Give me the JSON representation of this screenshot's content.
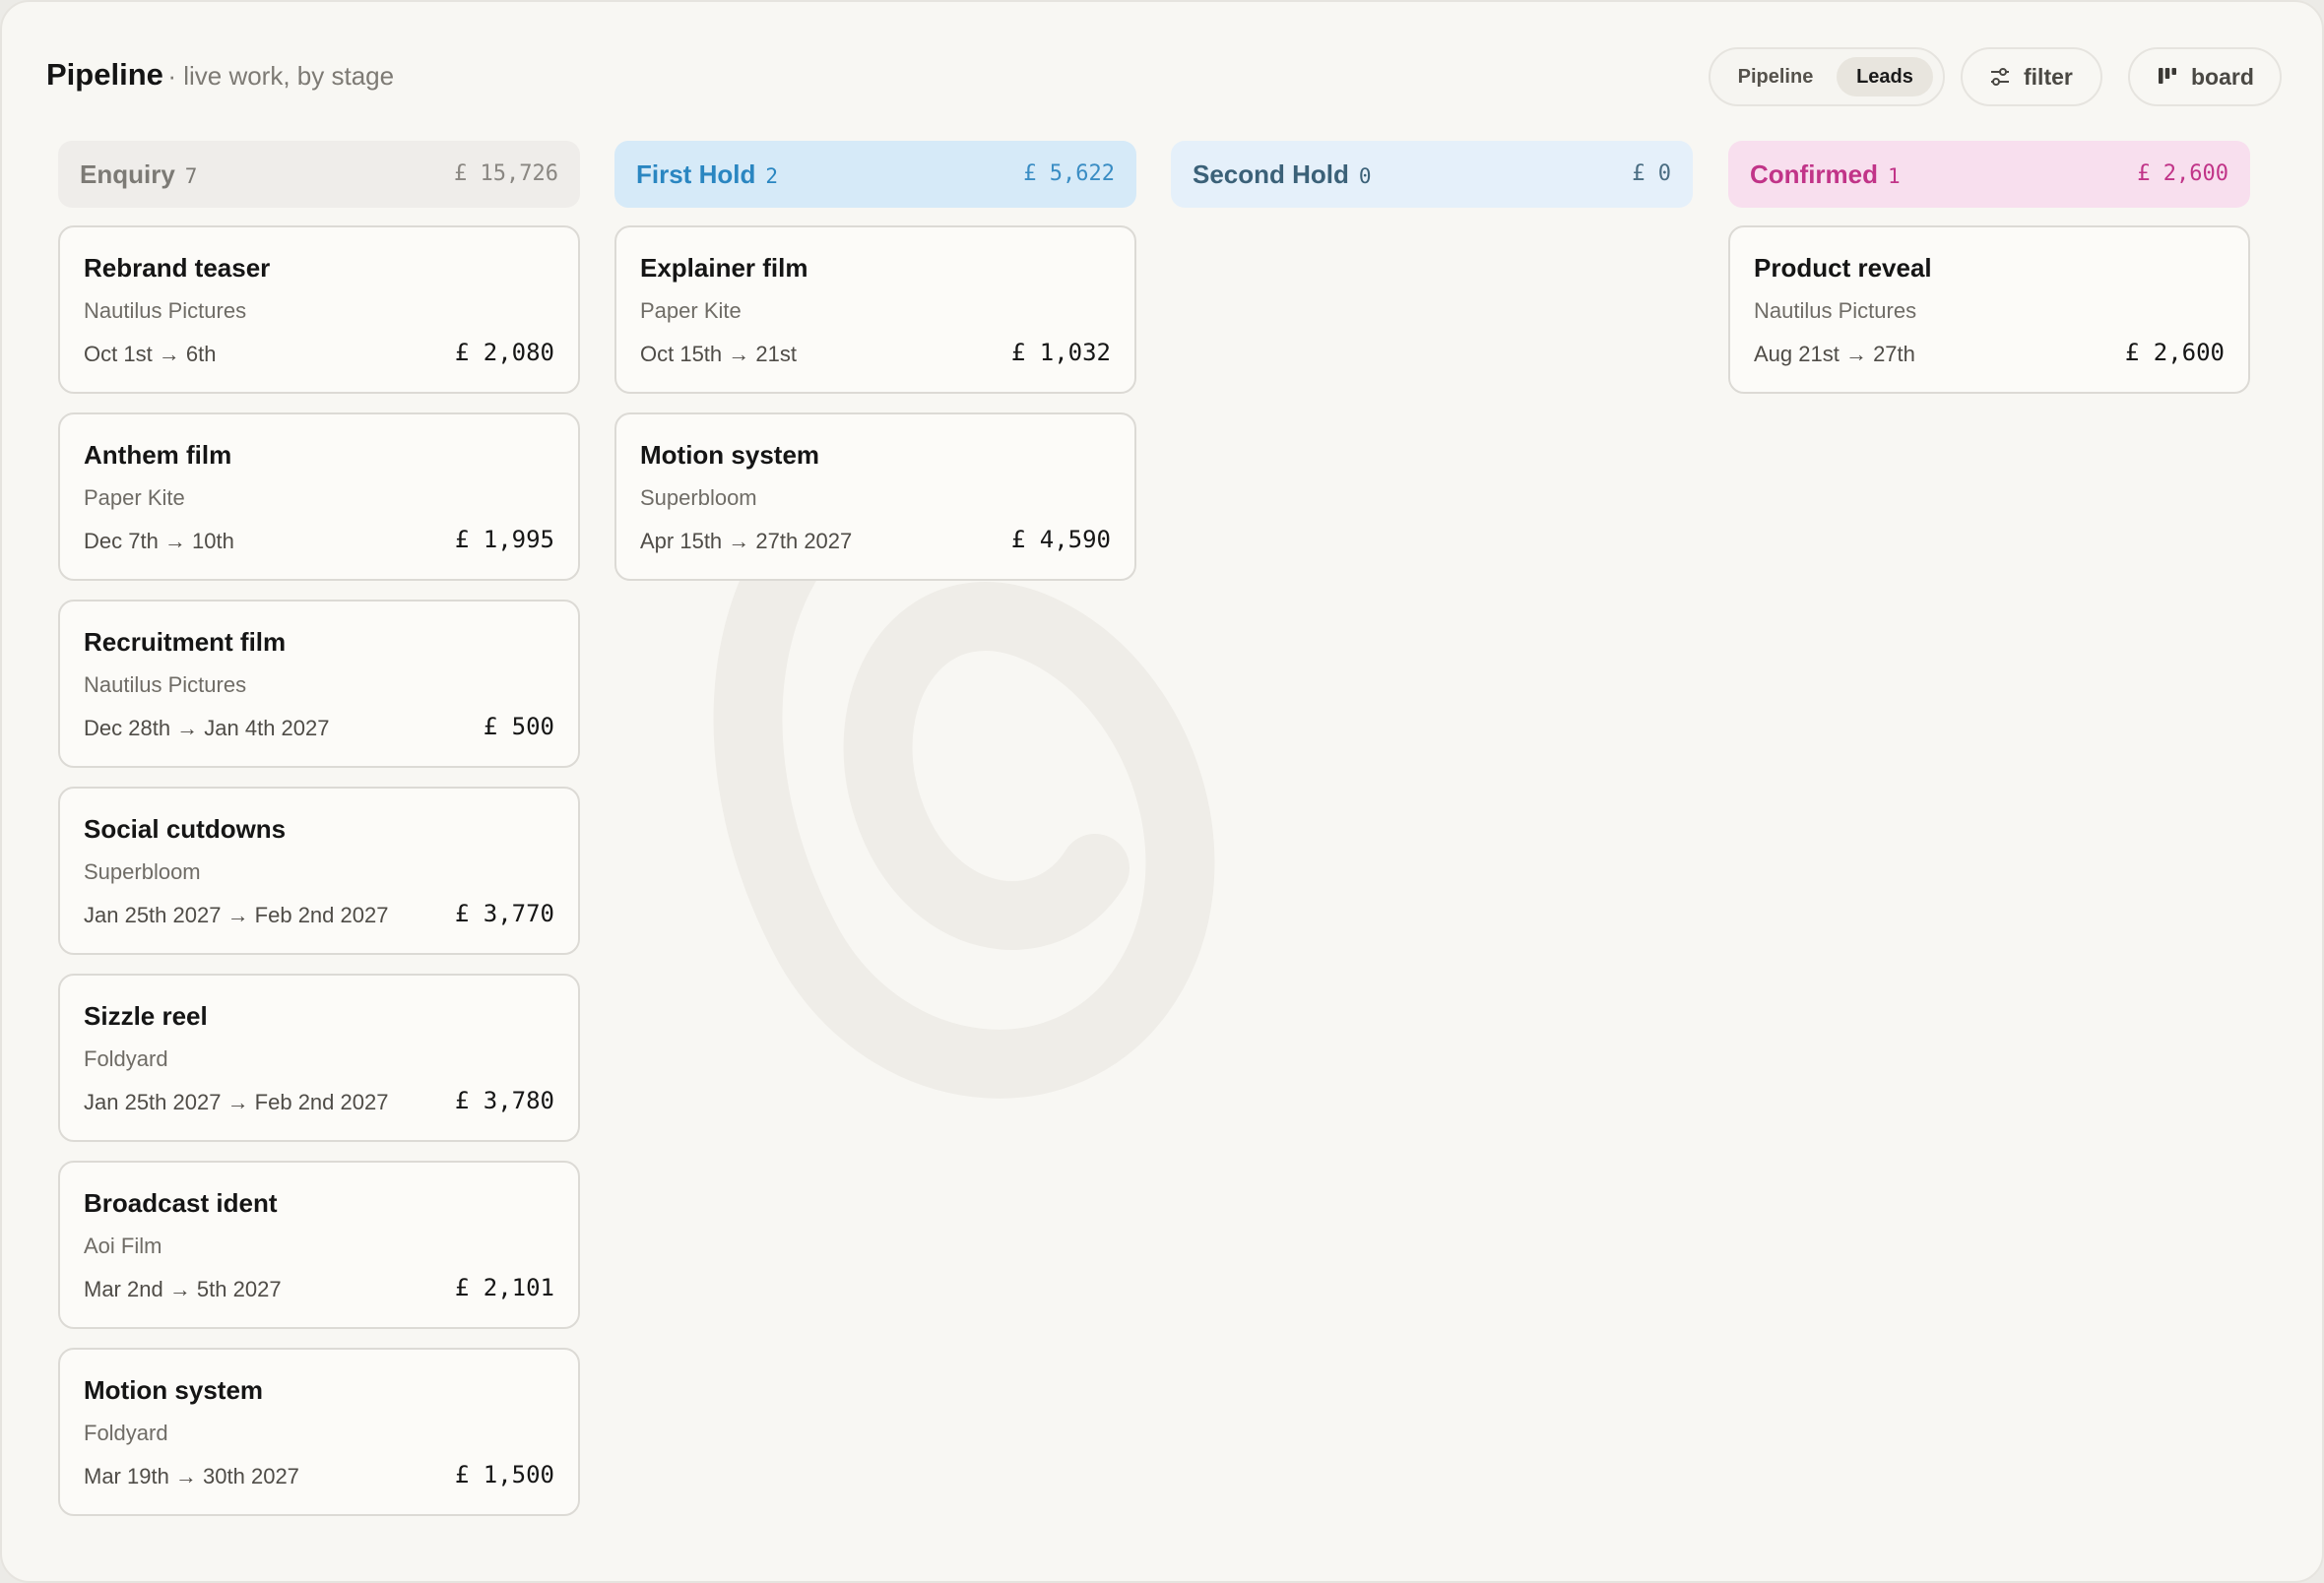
{
  "header": {
    "title": "Pipeline",
    "subtitle": "· live work, by stage",
    "view_toggle": {
      "pipeline_label": "Pipeline",
      "leads_label": "Leads",
      "active": "Leads"
    },
    "filter_label": "filter",
    "board_label": "board"
  },
  "colors": {
    "enquiry": {
      "bg": "#efedea",
      "text": "#7c7a75"
    },
    "first_hold": {
      "bg": "#d6eaf8",
      "text": "#2a86c1"
    },
    "second_hold": {
      "bg": "#e5f0fa",
      "text": "#3b6178"
    },
    "confirmed": {
      "bg": "#f8dfee",
      "text": "#c13488"
    }
  },
  "columns": [
    {
      "name": "Enquiry",
      "count": "7",
      "total": "£ 15,726",
      "cards": [
        {
          "title": "Rebrand teaser",
          "client": "Nautilus Pictures",
          "dates": "Oct 1st → 6th",
          "price": "£ 2,080"
        },
        {
          "title": "Anthem film",
          "client": "Paper Kite",
          "dates": "Dec 7th → 10th",
          "price": "£ 1,995"
        },
        {
          "title": "Recruitment film",
          "client": "Nautilus Pictures",
          "dates": "Dec 28th → Jan 4th 2027",
          "price": "£ 500"
        },
        {
          "title": "Social cutdowns",
          "client": "Superbloom",
          "dates": "Jan 25th 2027 → Feb 2nd 2027",
          "price": "£ 3,770"
        },
        {
          "title": "Sizzle reel",
          "client": "Foldyard",
          "dates": "Jan 25th 2027 → Feb 2nd 2027",
          "price": "£ 3,780"
        },
        {
          "title": "Broadcast ident",
          "client": "Aoi Film",
          "dates": "Mar 2nd → 5th 2027",
          "price": "£ 2,101"
        },
        {
          "title": "Motion system",
          "client": "Foldyard",
          "dates": "Mar 19th → 30th 2027",
          "price": "£ 1,500"
        }
      ]
    },
    {
      "name": "First Hold",
      "count": "2",
      "total": "£ 5,622",
      "cards": [
        {
          "title": "Explainer film",
          "client": "Paper Kite",
          "dates": "Oct 15th → 21st",
          "price": "£ 1,032"
        },
        {
          "title": "Motion system",
          "client": "Superbloom",
          "dates": "Apr 15th → 27th 2027",
          "price": "£ 4,590"
        }
      ]
    },
    {
      "name": "Second Hold",
      "count": "0",
      "total": "£ 0",
      "cards": []
    },
    {
      "name": "Confirmed",
      "count": "1",
      "total": "£ 2,600",
      "cards": [
        {
          "title": "Product reveal",
          "client": "Nautilus Pictures",
          "dates": "Aug 21st → 27th",
          "price": "£ 2,600"
        }
      ]
    }
  ]
}
